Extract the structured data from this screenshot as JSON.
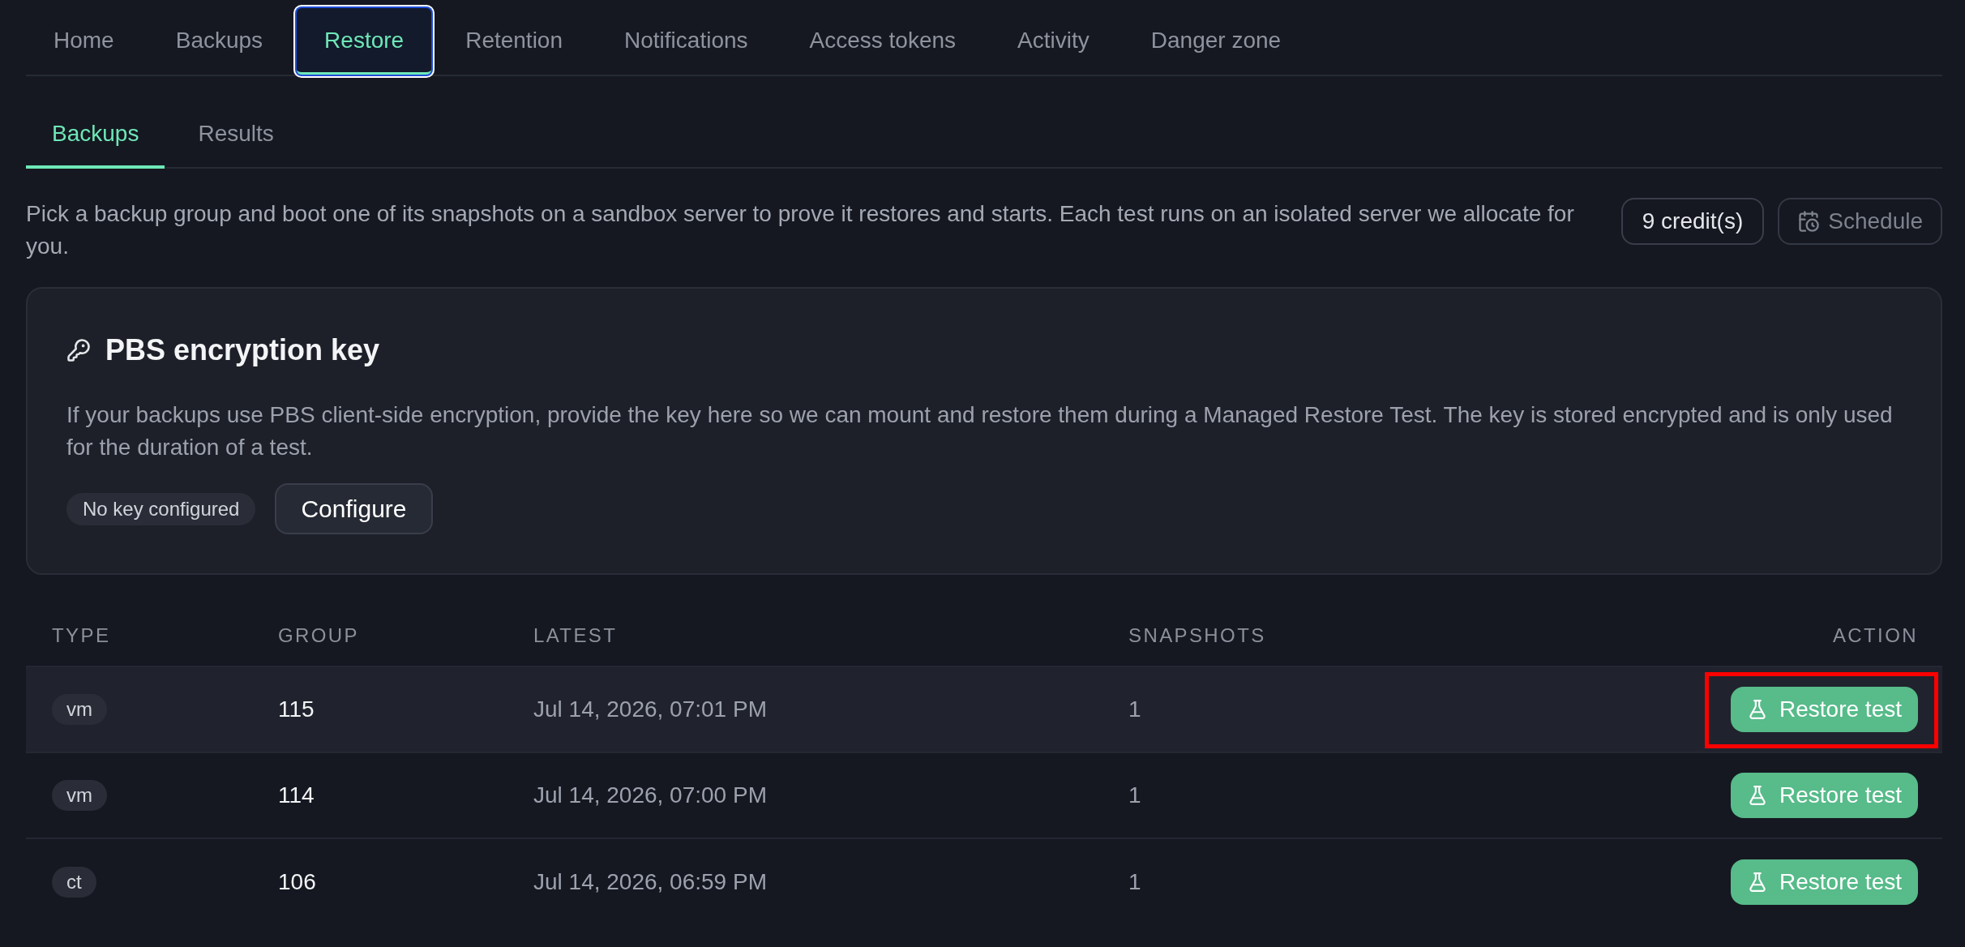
{
  "tabs": [
    {
      "label": "Home",
      "selected": false,
      "focused": false
    },
    {
      "label": "Backups",
      "selected": false,
      "focused": false
    },
    {
      "label": "Restore",
      "selected": true,
      "focused": true
    },
    {
      "label": "Retention",
      "selected": false,
      "focused": false
    },
    {
      "label": "Notifications",
      "selected": false,
      "focused": false
    },
    {
      "label": "Access tokens",
      "selected": false,
      "focused": false
    },
    {
      "label": "Activity",
      "selected": false,
      "focused": false
    },
    {
      "label": "Danger zone",
      "selected": false,
      "focused": false
    }
  ],
  "subtabs": [
    {
      "label": "Backups",
      "selected": true
    },
    {
      "label": "Results",
      "selected": false
    }
  ],
  "intro": {
    "text": "Pick a backup group and boot one of its snapshots on a sandbox server to prove it restores and starts. Each test runs on an isolated server we allocate for you.",
    "credits": "9 credit(s)",
    "schedule": {
      "label": "Schedule",
      "disabled": true
    }
  },
  "encryption_card": {
    "title": "PBS encryption key",
    "description": "If your backups use PBS client-side encryption, provide the key here so we can mount and restore them during a Managed Restore Test. The key is stored encrypted and is only used for the duration of a test.",
    "status": "No key configured",
    "configure_button": "Configure"
  },
  "table": {
    "columns": [
      "TYPE",
      "GROUP",
      "LATEST",
      "SNAPSHOTS",
      "ACTION"
    ],
    "rows": [
      {
        "type": "vm",
        "group": "115",
        "latest": "Jul 14, 2026, 07:01 PM",
        "snapshots": "1",
        "action": "Restore test",
        "hovered": true,
        "highlighted": true
      },
      {
        "type": "vm",
        "group": "114",
        "latest": "Jul 14, 2026, 07:00 PM",
        "snapshots": "1",
        "action": "Restore test",
        "hovered": false,
        "highlighted": false
      },
      {
        "type": "ct",
        "group": "106",
        "latest": "Jul 14, 2026, 06:59 PM",
        "snapshots": "1",
        "action": "Restore test",
        "hovered": false,
        "highlighted": false
      }
    ]
  }
}
